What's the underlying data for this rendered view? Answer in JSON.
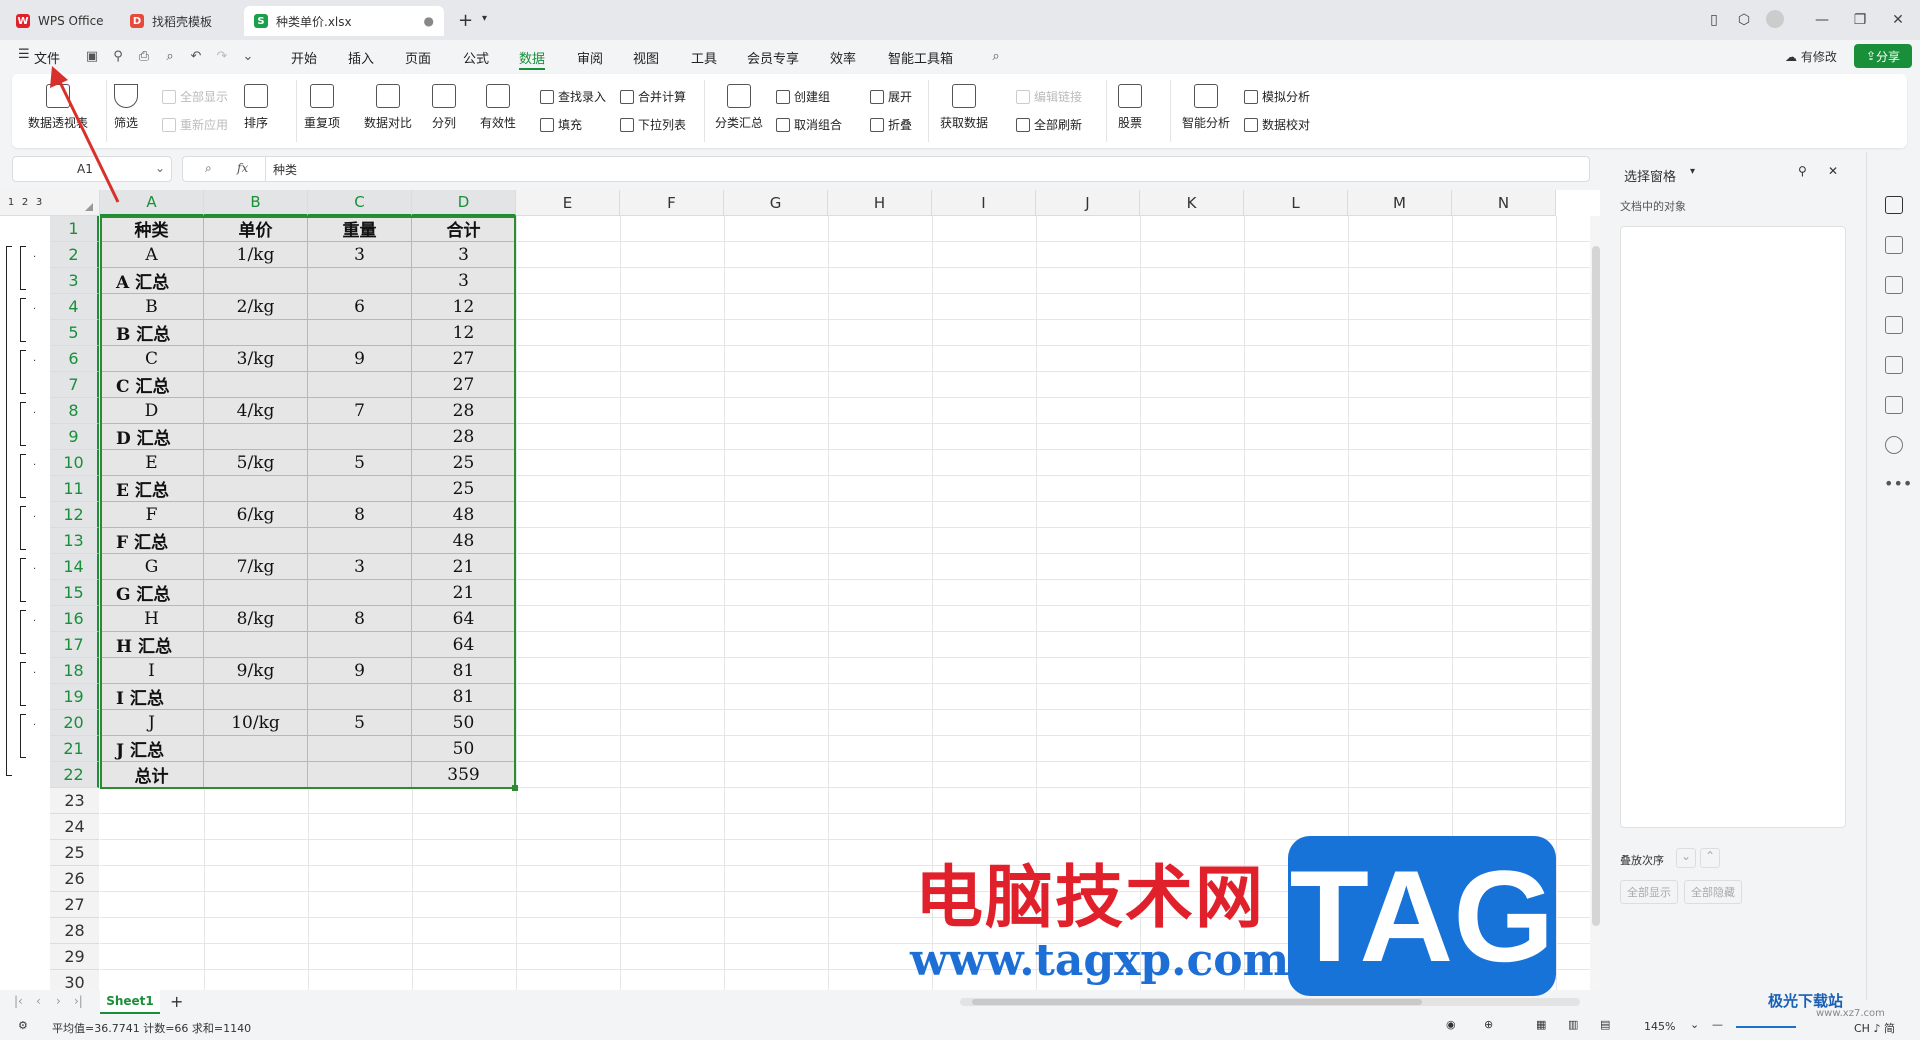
{
  "titlebar": {
    "tabs": [
      {
        "label": "WPS Office",
        "icon": "wps-logo-icon"
      },
      {
        "label": "找稻壳模板",
        "icon": "docer-icon"
      },
      {
        "label": "种类单价.xlsx",
        "icon": "sheet-icon"
      }
    ],
    "new_tab": "+"
  },
  "menubar": {
    "file": "文件",
    "items": [
      "开始",
      "插入",
      "页面",
      "公式",
      "数据",
      "审阅",
      "视图",
      "工具",
      "会员专享",
      "效率",
      "智能工具箱"
    ],
    "active": "数据",
    "changes": "有修改",
    "share": "分享"
  },
  "ribbon": {
    "pivot": "数据透视表",
    "filter": "筛选",
    "show_all": "全部显示",
    "reapply": "重新应用",
    "sort": "排序",
    "duplicates": "重复项",
    "compare": "数据对比",
    "split": "分列",
    "validity": "有效性",
    "lookup": "查找录入",
    "fill": "填充",
    "merge_calc": "合并计算",
    "dropdown": "下拉列表",
    "subtotal": "分类汇总",
    "create_group": "创建组",
    "ungroup": "取消组合",
    "expand": "展开",
    "collapse": "折叠",
    "get_data": "获取数据",
    "edit_links": "编辑链接",
    "refresh_all": "全部刷新",
    "stocks": "股票",
    "smart_analysis": "智能分析",
    "simulation": "模拟分析",
    "verify": "数据校对"
  },
  "formula": {
    "cell_ref": "A1",
    "fx": "fx",
    "value": "种类"
  },
  "columns": [
    "A",
    "B",
    "C",
    "D",
    "E",
    "F",
    "G",
    "H",
    "I",
    "J",
    "K",
    "L",
    "M",
    "N"
  ],
  "outline_levels": [
    "1",
    "2",
    "3"
  ],
  "rows": [
    "1",
    "2",
    "3",
    "4",
    "5",
    "6",
    "7",
    "8",
    "9",
    "10",
    "11",
    "12",
    "13",
    "14",
    "15",
    "16",
    "17",
    "18",
    "19",
    "20",
    "21",
    "22",
    "23",
    "24",
    "25",
    "26",
    "27",
    "28",
    "29",
    "30"
  ],
  "table": [
    [
      "种类",
      "单价",
      "重量",
      "合计"
    ],
    [
      "A",
      "1/kg",
      "3",
      "3"
    ],
    [
      "A 汇总",
      "",
      "",
      "3"
    ],
    [
      "B",
      "2/kg",
      "6",
      "12"
    ],
    [
      "B 汇总",
      "",
      "",
      "12"
    ],
    [
      "C",
      "3/kg",
      "9",
      "27"
    ],
    [
      "C 汇总",
      "",
      "",
      "27"
    ],
    [
      "D",
      "4/kg",
      "7",
      "28"
    ],
    [
      "D 汇总",
      "",
      "",
      "28"
    ],
    [
      "E",
      "5/kg",
      "5",
      "25"
    ],
    [
      "E 汇总",
      "",
      "",
      "25"
    ],
    [
      "F",
      "6/kg",
      "8",
      "48"
    ],
    [
      "F 汇总",
      "",
      "",
      "48"
    ],
    [
      "G",
      "7/kg",
      "3",
      "21"
    ],
    [
      "G 汇总",
      "",
      "",
      "21"
    ],
    [
      "H",
      "8/kg",
      "8",
      "64"
    ],
    [
      "H 汇总",
      "",
      "",
      "64"
    ],
    [
      "I",
      "9/kg",
      "9",
      "81"
    ],
    [
      "I 汇总",
      "",
      "",
      "81"
    ],
    [
      "J",
      "10/kg",
      "5",
      "50"
    ],
    [
      "J 汇总",
      "",
      "",
      "50"
    ],
    [
      "总计",
      "",
      "",
      "359"
    ]
  ],
  "sheet": {
    "name": "Sheet1",
    "add": "+"
  },
  "panel": {
    "title": "选择窗格",
    "objects": "文档中的对象",
    "order": "叠放次序",
    "show_all": "全部显示",
    "hide_all": "全部隐藏"
  },
  "status": {
    "summary": "平均值=36.7741  计数=66  求和=1140",
    "zoom": "145%"
  },
  "watermark": {
    "cn": "电脑技术网",
    "url": "www.tagxp.com",
    "tag": "TAG",
    "site": "极光下载站",
    "site_url": "www.xz7.com",
    "ime": "CH ♪ 简"
  },
  "colors": {
    "accent": "#1a8f3a",
    "selection_border": "#2e8b2e",
    "arrow": "#d9302b"
  }
}
